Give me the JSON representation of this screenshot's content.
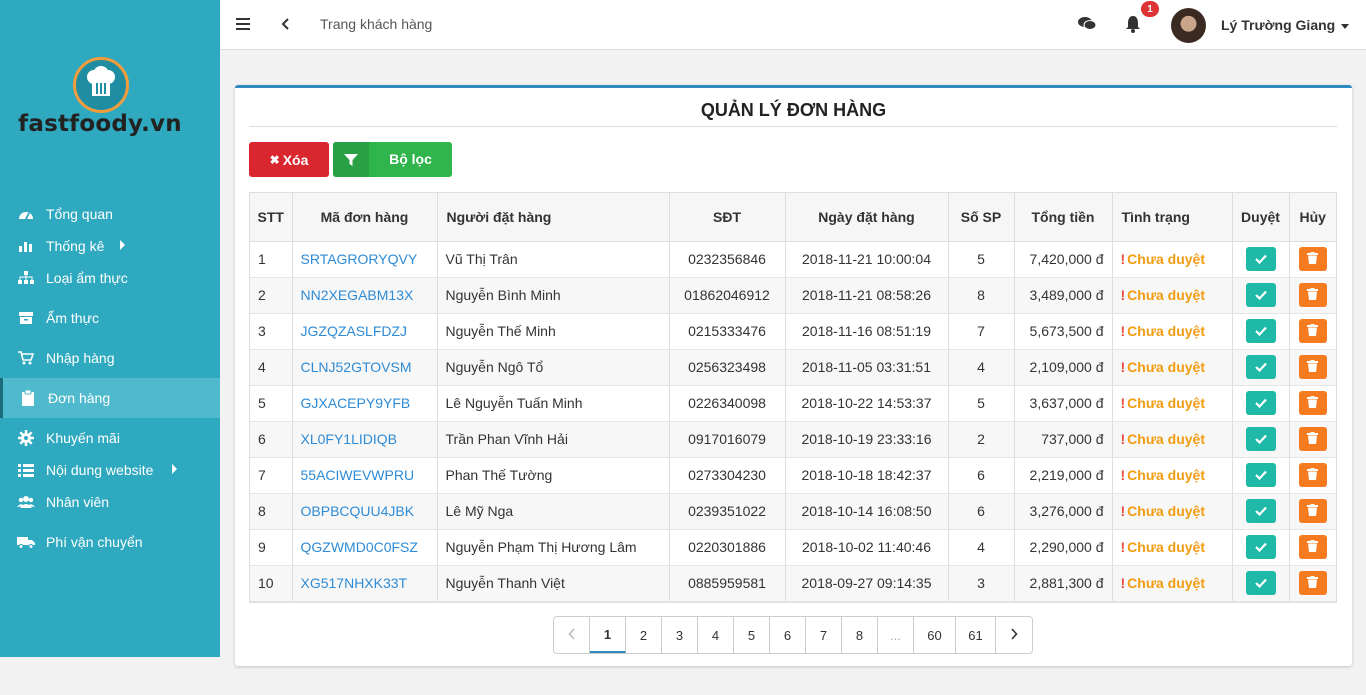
{
  "brand": {
    "name": "fastfoody.vn",
    "accent": "#2ea9bf",
    "logo_ring": "#f39c3b"
  },
  "sidebar": {
    "items": [
      {
        "label": "Tổng quan",
        "icon": "dashboard-icon"
      },
      {
        "label": "Thống kê",
        "icon": "bar-chart-icon",
        "has_submenu": true
      },
      {
        "label": "Loại ẩm thực",
        "icon": "sitemap-icon"
      },
      {
        "label": "Ẩm thực",
        "icon": "box-icon"
      },
      {
        "label": "Nhập hàng",
        "icon": "cart-icon"
      },
      {
        "label": "Đơn hàng",
        "icon": "clipboard-icon",
        "active": true
      },
      {
        "label": "Khuyến mãi",
        "icon": "gear-icon"
      },
      {
        "label": "Nội dung website",
        "icon": "list-icon",
        "has_submenu": true
      },
      {
        "label": "Nhân viên",
        "icon": "users-icon"
      },
      {
        "label": "Phí vận chuyển",
        "icon": "truck-icon"
      }
    ]
  },
  "header": {
    "breadcrumb": "Trang khách hàng",
    "notification_count": "1",
    "user_name": "Lý Trường Giang"
  },
  "panel": {
    "title": "QUẢN LÝ ĐƠN HÀNG",
    "delete_label": "Xóa",
    "filter_label": "Bộ lọc"
  },
  "table": {
    "columns": [
      "STT",
      "Mã đơn hàng",
      "Người đặt hàng",
      "SĐT",
      "Ngày đặt hàng",
      "Số SP",
      "Tổng tiền",
      "Tình trạng",
      "Duyệt",
      "Hủy"
    ],
    "rows": [
      {
        "stt": "1",
        "code": "SRTAGRORYQVY",
        "customer": "Vũ Thị Trân",
        "phone": "0232356846",
        "date": "2018-11-21 10:00:04",
        "qty": "5",
        "total": "7,420,000 đ",
        "status": "Chưa duyệt"
      },
      {
        "stt": "2",
        "code": "NN2XEGABM13X",
        "customer": "Nguyễn Bình Minh",
        "phone": "01862046912",
        "date": "2018-11-21 08:58:26",
        "qty": "8",
        "total": "3,489,000 đ",
        "status": "Chưa duyệt"
      },
      {
        "stt": "3",
        "code": "JGZQZASLFDZJ",
        "customer": "Nguyễn Thế Minh",
        "phone": "0215333476",
        "date": "2018-11-16 08:51:19",
        "qty": "7",
        "total": "5,673,500 đ",
        "status": "Chưa duyệt"
      },
      {
        "stt": "4",
        "code": "CLNJ52GTOVSM",
        "customer": "Nguyễn Ngô Tổ",
        "phone": "0256323498",
        "date": "2018-11-05 03:31:51",
        "qty": "4",
        "total": "2,109,000 đ",
        "status": "Chưa duyệt"
      },
      {
        "stt": "5",
        "code": "GJXACEPY9YFB",
        "customer": "Lê Nguyễn Tuấn Minh",
        "phone": "0226340098",
        "date": "2018-10-22 14:53:37",
        "qty": "5",
        "total": "3,637,000 đ",
        "status": "Chưa duyệt"
      },
      {
        "stt": "6",
        "code": "XL0FY1LIDIQB",
        "customer": "Trần Phan Vĩnh Hải",
        "phone": "0917016079",
        "date": "2018-10-19 23:33:16",
        "qty": "2",
        "total": "737,000 đ",
        "status": "Chưa duyệt"
      },
      {
        "stt": "7",
        "code": "55ACIWEVWPRU",
        "customer": "Phan Thế Tường",
        "phone": "0273304230",
        "date": "2018-10-18 18:42:37",
        "qty": "6",
        "total": "2,219,000 đ",
        "status": "Chưa duyệt"
      },
      {
        "stt": "8",
        "code": "OBPBCQUU4JBK",
        "customer": "Lê Mỹ Nga",
        "phone": "0239351022",
        "date": "2018-10-14 16:08:50",
        "qty": "6",
        "total": "3,276,000 đ",
        "status": "Chưa duyệt"
      },
      {
        "stt": "9",
        "code": "QGZWMD0C0FSZ",
        "customer": "Nguyễn Phạm Thị Hương Lâm",
        "phone": "0220301886",
        "date": "2018-10-02 11:40:46",
        "qty": "4",
        "total": "2,290,000 đ",
        "status": "Chưa duyệt"
      },
      {
        "stt": "10",
        "code": "XG517NHXK33T",
        "customer": "Nguyễn Thanh Việt",
        "phone": "0885959581",
        "date": "2018-09-27 09:14:35",
        "qty": "3",
        "total": "2,881,300 đ",
        "status": "Chưa duyệt"
      }
    ]
  },
  "pagination": {
    "pages": [
      "1",
      "2",
      "3",
      "4",
      "5",
      "6",
      "7",
      "8",
      "...",
      "60",
      "61"
    ],
    "current": "1"
  }
}
